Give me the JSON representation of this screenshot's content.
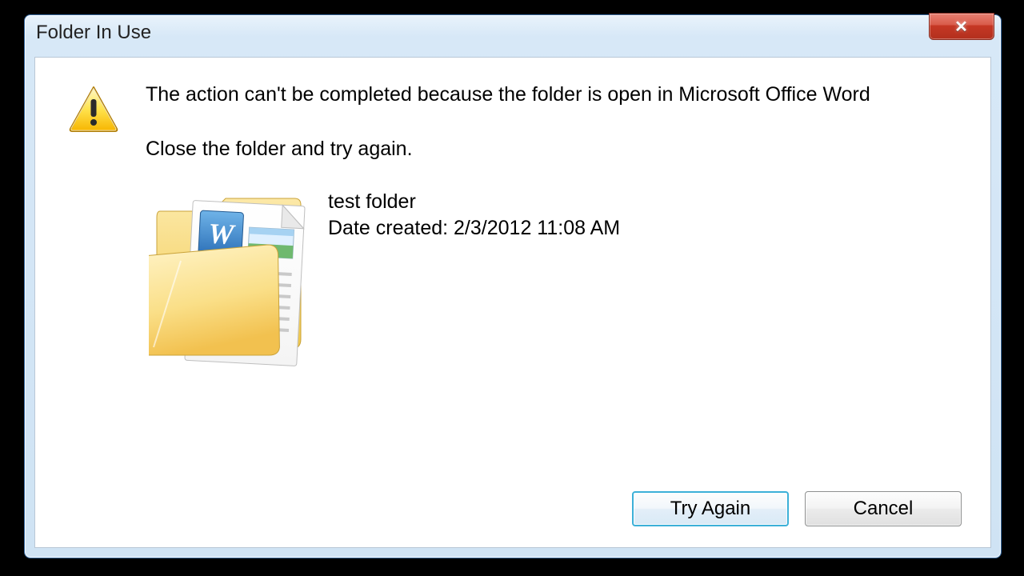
{
  "dialog": {
    "title": "Folder In Use",
    "primary_message": "The action can't be completed because the folder is open in Microsoft Office Word",
    "instruction": "Close the folder and try again.",
    "item": {
      "name": "test folder",
      "date_created_line": "Date created: 2/3/2012 11:08 AM"
    },
    "buttons": {
      "try_again": "Try Again",
      "cancel": "Cancel"
    }
  }
}
